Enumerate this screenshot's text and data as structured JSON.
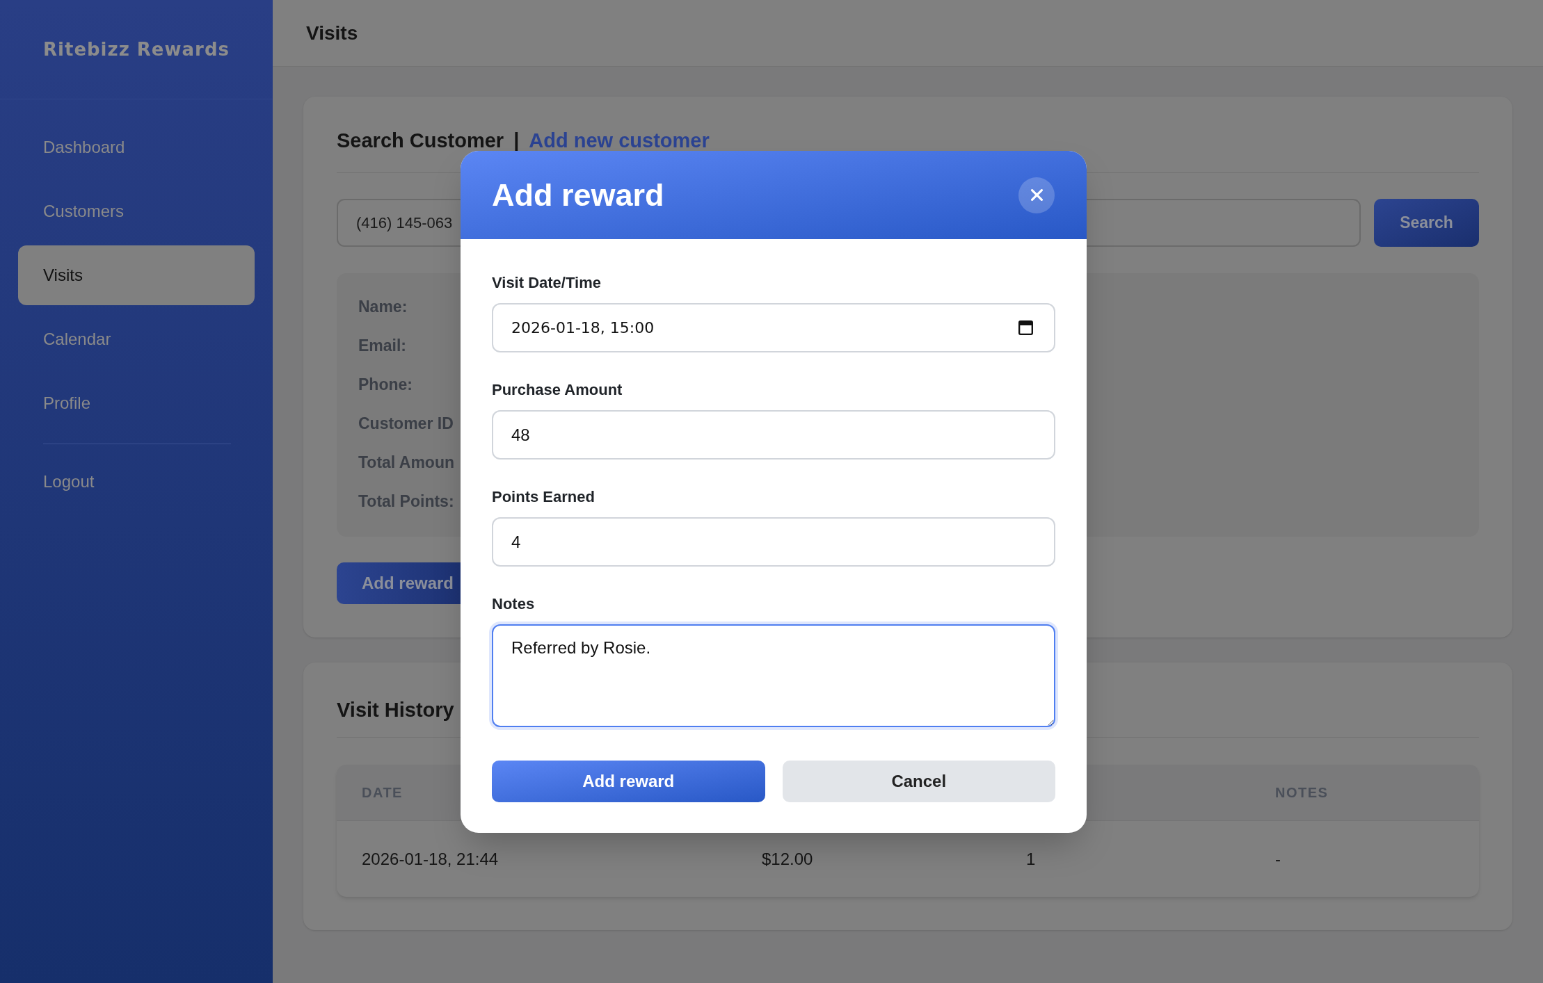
{
  "sidebar": {
    "logo": "Ritebizz Rewards",
    "items": [
      {
        "label": "Dashboard",
        "selected": false
      },
      {
        "label": "Customers",
        "selected": false
      },
      {
        "label": "Visits",
        "selected": true
      },
      {
        "label": "Calendar",
        "selected": false
      },
      {
        "label": "Profile",
        "selected": false
      }
    ],
    "footer_items": [
      {
        "label": "Logout",
        "selected": false
      }
    ]
  },
  "header": {
    "title": "Visits"
  },
  "search_card": {
    "title": "Search Customer",
    "separator": "|",
    "add_link": "Add new customer",
    "search_field": {
      "value": "(416) 145-063"
    },
    "search_button": "Search",
    "customer_fields": [
      "Name:",
      "Email:",
      "Phone:",
      "Customer ID",
      "Total Amoun",
      "Total Points:"
    ],
    "add_reward_button": "Add reward"
  },
  "visit_history": {
    "title": "Visit History",
    "columns": {
      "date": "DATE",
      "notes": "NOTES"
    },
    "rows": [
      {
        "date": "2026-01-18, 21:44",
        "column_2": "$12.00",
        "column_3": "1",
        "notes": "-"
      }
    ]
  },
  "modal": {
    "title": "Add reward",
    "fields": [
      {
        "kind": "datetime",
        "label": "Visit Date/Time",
        "value": "2026-01-18, 15:00",
        "focused": false
      },
      {
        "kind": "text",
        "label": "Purchase Amount",
        "value": "48",
        "focused": false
      },
      {
        "kind": "text",
        "label": "Points Earned",
        "value": "4",
        "focused": false
      },
      {
        "kind": "textarea",
        "label": "Notes",
        "value": "Referred by Rosie.",
        "focused": true
      }
    ],
    "buttons": [
      {
        "kind": "primary",
        "label": "Add reward"
      },
      {
        "kind": "secondary",
        "label": "Cancel"
      }
    ]
  }
}
